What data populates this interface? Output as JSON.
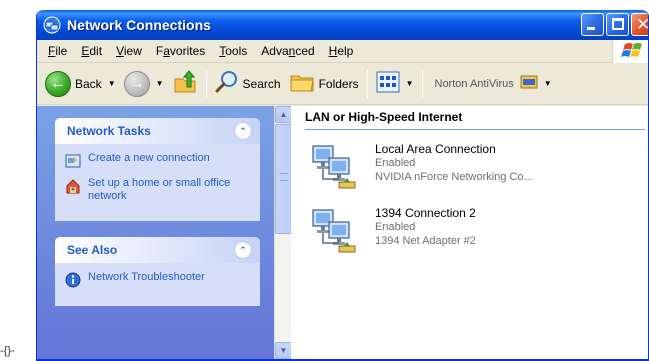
{
  "stray_text": "-{}-",
  "window": {
    "title": "Network Connections",
    "menu": [
      "File",
      "Edit",
      "View",
      "Favorites",
      "Tools",
      "Advanced",
      "Help"
    ],
    "menu_mnemonics": [
      "F",
      "E",
      "V",
      "a",
      "T",
      "n",
      "H"
    ]
  },
  "toolbar": {
    "back_label": "Back",
    "search_label": "Search",
    "folders_label": "Folders",
    "norton_label": "Norton AntiVirus"
  },
  "taskpane": {
    "network_tasks": {
      "title": "Network Tasks",
      "items": [
        {
          "label": "Create a new connection"
        },
        {
          "label": "Set up a home or small office network"
        }
      ]
    },
    "see_also": {
      "title": "See Also",
      "items": [
        {
          "label": "Network Troubleshooter"
        }
      ]
    }
  },
  "content": {
    "group_title": "LAN or High-Speed Internet",
    "connections": [
      {
        "name": "Local Area Connection",
        "status": "Enabled",
        "device": "NVIDIA nForce Networking Co..."
      },
      {
        "name": "1394 Connection 2",
        "status": "Enabled",
        "device": "1394 Net Adapter #2"
      }
    ]
  },
  "colors": {
    "titlebar": "#0a5fe8",
    "taskpane_bg": "#7ba2e7",
    "link": "#215dc6",
    "chrome": "#ece9d8"
  }
}
